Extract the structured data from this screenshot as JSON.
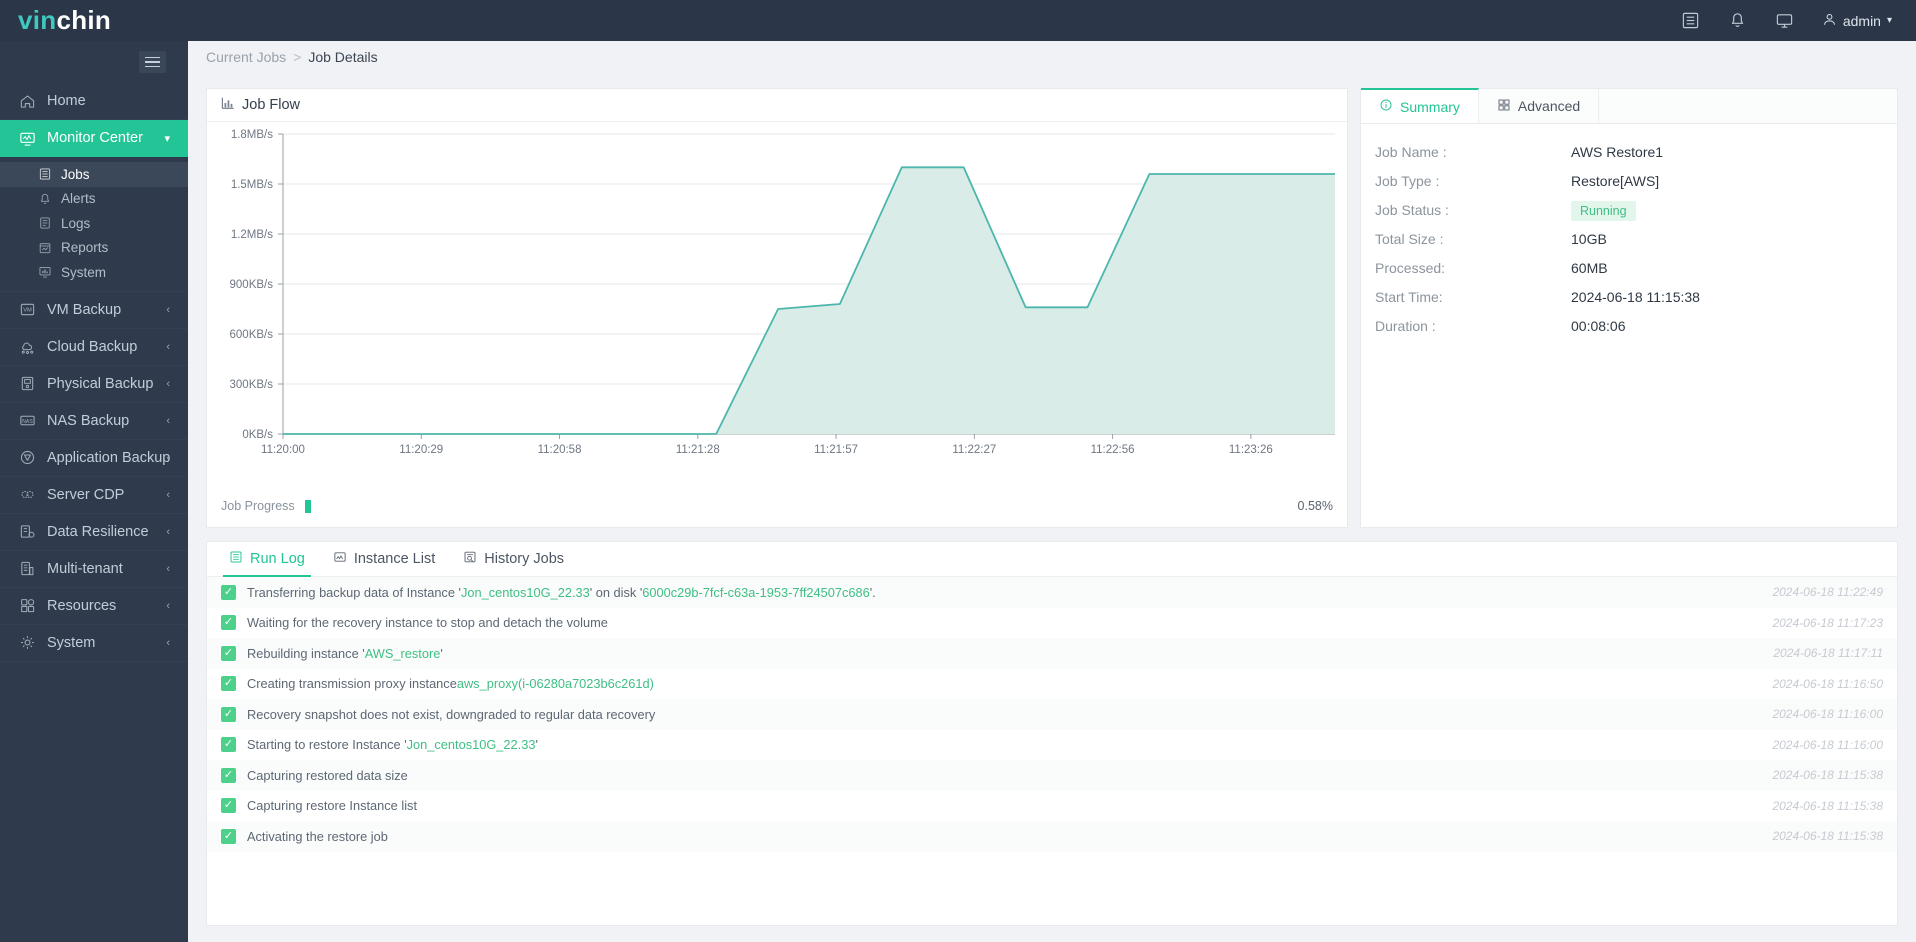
{
  "brand": {
    "prefix": "vin",
    "suffix": "chin"
  },
  "topbar": {
    "icons": [
      {
        "name": "list-icon"
      },
      {
        "name": "bell-icon"
      },
      {
        "name": "monitor-icon"
      }
    ],
    "user": "admin"
  },
  "sidebar": {
    "items": [
      {
        "label": "Home",
        "icon": "home-icon",
        "active": false,
        "expandable": false
      },
      {
        "label": "Monitor Center",
        "icon": "monitor-center-icon",
        "active": true,
        "expandable": true
      },
      {
        "label": "VM Backup",
        "icon": "vm-icon",
        "active": false,
        "expandable": true
      },
      {
        "label": "Cloud Backup",
        "icon": "cloud-icon",
        "active": false,
        "expandable": true
      },
      {
        "label": "Physical Backup",
        "icon": "server-icon",
        "active": false,
        "expandable": true
      },
      {
        "label": "NAS Backup",
        "icon": "nas-icon",
        "active": false,
        "expandable": true
      },
      {
        "label": "Application Backup",
        "icon": "app-icon",
        "active": false,
        "expandable": true
      },
      {
        "label": "Server CDP",
        "icon": "cdp-icon",
        "active": false,
        "expandable": true
      },
      {
        "label": "Data Resilience",
        "icon": "resilience-icon",
        "active": false,
        "expandable": true
      },
      {
        "label": "Multi-tenant",
        "icon": "tenant-icon",
        "active": false,
        "expandable": true
      },
      {
        "label": "Resources",
        "icon": "resources-icon",
        "active": false,
        "expandable": true
      },
      {
        "label": "System",
        "icon": "system-icon",
        "active": false,
        "expandable": true
      }
    ],
    "submenu": [
      {
        "label": "Jobs",
        "icon": "jobs-icon",
        "active": true
      },
      {
        "label": "Alerts",
        "icon": "alerts-icon",
        "active": false
      },
      {
        "label": "Logs",
        "icon": "logs-icon",
        "active": false
      },
      {
        "label": "Reports",
        "icon": "reports-icon",
        "active": false
      },
      {
        "label": "System",
        "icon": "system-monitor-icon",
        "active": false
      }
    ]
  },
  "breadcrumb": {
    "parent": "Current Jobs",
    "separator": ">",
    "current": "Job Details"
  },
  "flow_panel": {
    "title": "Job Flow"
  },
  "progress": {
    "label": "Job Progress",
    "percent_text": "0.58%",
    "percent": 0.58
  },
  "summary": {
    "tabs": [
      {
        "label": "Summary",
        "icon": "info-icon",
        "active": true
      },
      {
        "label": "Advanced",
        "icon": "grid-icon",
        "active": false
      }
    ],
    "fields": [
      {
        "key": "Job Name :",
        "value": "AWS Restore1",
        "type": "text"
      },
      {
        "key": "Job Type :",
        "value": "Restore[AWS]",
        "type": "text"
      },
      {
        "key": "Job Status :",
        "value": "Running",
        "type": "badge"
      },
      {
        "key": "Total Size :",
        "value": "10GB",
        "type": "text"
      },
      {
        "key": "Processed:",
        "value": "60MB",
        "type": "text"
      },
      {
        "key": "Start Time:",
        "value": "2024-06-18 11:15:38",
        "type": "text"
      },
      {
        "key": "Duration :",
        "value": "00:08:06",
        "type": "text"
      }
    ]
  },
  "log_panel": {
    "tabs": [
      {
        "label": "Run Log",
        "icon": "runlog-icon",
        "active": true
      },
      {
        "label": "Instance List",
        "icon": "instance-icon",
        "active": false
      },
      {
        "label": "History Jobs",
        "icon": "history-icon",
        "active": false
      }
    ],
    "rows": [
      {
        "segments": [
          {
            "t": "Transferring backup data of Instance '",
            "hl": false
          },
          {
            "t": "Jon_centos10G_22.33",
            "hl": true
          },
          {
            "t": "' on disk '",
            "hl": false
          },
          {
            "t": "6000c29b-7fcf-c63a-1953-7ff24507c686",
            "hl": true
          },
          {
            "t": "'.",
            "hl": false
          }
        ],
        "time": "2024-06-18 11:22:49"
      },
      {
        "segments": [
          {
            "t": "Waiting for the recovery instance to stop and detach the volume",
            "hl": false
          }
        ],
        "time": "2024-06-18 11:17:23"
      },
      {
        "segments": [
          {
            "t": "Rebuilding instance '",
            "hl": false
          },
          {
            "t": "AWS_restore",
            "hl": true
          },
          {
            "t": "'",
            "hl": false
          }
        ],
        "time": "2024-06-18 11:17:11"
      },
      {
        "segments": [
          {
            "t": "Creating transmission proxy instance",
            "hl": false
          },
          {
            "t": "aws_proxy(i-06280a7023b6c261d)",
            "hl": true
          }
        ],
        "time": "2024-06-18 11:16:50"
      },
      {
        "segments": [
          {
            "t": "Recovery snapshot does not exist, downgraded to regular data recovery",
            "hl": false
          }
        ],
        "time": "2024-06-18 11:16:00"
      },
      {
        "segments": [
          {
            "t": "Starting to restore Instance '",
            "hl": false
          },
          {
            "t": "Jon_centos10G_22.33",
            "hl": true
          },
          {
            "t": "'",
            "hl": false
          }
        ],
        "time": "2024-06-18 11:16:00"
      },
      {
        "segments": [
          {
            "t": "Capturing restored data size",
            "hl": false
          }
        ],
        "time": "2024-06-18 11:15:38"
      },
      {
        "segments": [
          {
            "t": "Capturing restore Instance list",
            "hl": false
          }
        ],
        "time": "2024-06-18 11:15:38"
      },
      {
        "segments": [
          {
            "t": "Activating the restore job",
            "hl": false
          }
        ],
        "time": "2024-06-18 11:15:38"
      }
    ]
  },
  "colors": {
    "accent": "#23c495",
    "sidebar_bg": "#2f3b4c",
    "topbar_bg": "#2b3648",
    "chart_line": "#4db6ac",
    "chart_fill": "#d9ece8",
    "status_running": "#3fbf84"
  },
  "chart_data": {
    "type": "area",
    "title": "Job Flow",
    "xlabel": "",
    "ylabel": "",
    "grid": true,
    "legend": "none",
    "ytick_labels": [
      "1.8MB/s",
      "1.5MB/s",
      "1.2MB/s",
      "900KB/s",
      "600KB/s",
      "300KB/s",
      "0KB/s"
    ],
    "ytick_values": [
      1800,
      1500,
      1200,
      900,
      600,
      300,
      0
    ],
    "ylim": [
      0,
      1800
    ],
    "yunit": "KB/s",
    "xtick_labels": [
      "11:20:00",
      "11:20:29",
      "11:20:58",
      "11:21:28",
      "11:21:57",
      "11:22:27",
      "11:22:56",
      "11:23:26"
    ],
    "series": [
      {
        "name": "Throughput",
        "x": [
          "11:20:00",
          "11:20:29",
          "11:20:58",
          "11:21:28",
          "11:21:57",
          "11:22:27",
          "11:22:56",
          "11:23:00",
          "11:23:03",
          "11:23:08",
          "11:23:11",
          "11:23:14",
          "11:23:17",
          "11:23:20",
          "11:23:23",
          "11:23:26",
          "11:23:40",
          "11:23:55"
        ],
        "values": [
          0,
          0,
          0,
          0,
          0,
          0,
          0,
          0,
          750,
          780,
          1600,
          1600,
          760,
          760,
          1560,
          1560,
          1560,
          1560
        ]
      }
    ]
  }
}
